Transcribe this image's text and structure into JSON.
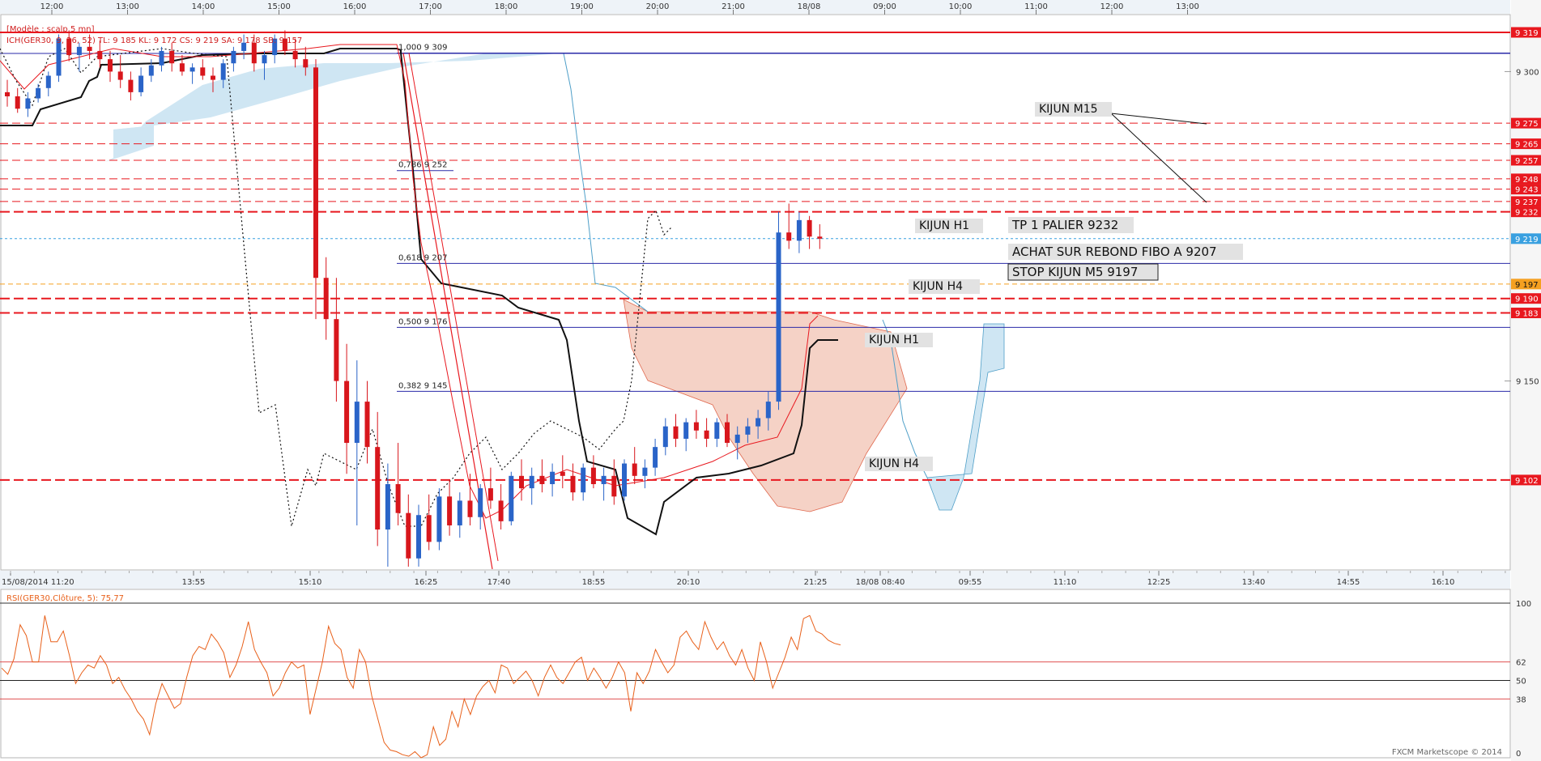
{
  "chart_data": {
    "type": "candlestick",
    "instrument_header": "[Modèle : scalp 5 mn]",
    "indicator_header": "ICH(GER30, 9, 26, 52) TL: 9 185 KL: 9 172 CS: 9 219 SA: 9 178 SB: 9 157",
    "top_time_labels": [
      "12:00",
      "13:00",
      "14:00",
      "15:00",
      "16:00",
      "17:00",
      "18:00",
      "19:00",
      "20:00",
      "21:00",
      "18/08",
      "09:00",
      "10:00",
      "11:00",
      "12:00",
      "13:00"
    ],
    "bottom_time_labels": [
      "15/08/2014 11:20",
      "13:55",
      "15:10",
      "16:25",
      "17:40",
      "18:55",
      "20:10",
      "21:25",
      "18/08 08:40",
      "09:55",
      "11:10",
      "12:25",
      "13:40",
      "14:55",
      "16:10"
    ],
    "y_axis": {
      "ticks": [
        "9 300",
        "9 150"
      ],
      "ylim": [
        9060,
        9330
      ]
    },
    "price_tags": [
      {
        "label": "9 319",
        "value": 9319,
        "color": "#e8181f"
      },
      {
        "label": "9 275",
        "value": 9275,
        "color": "#e8181f"
      },
      {
        "label": "9 265",
        "value": 9265,
        "color": "#e8181f"
      },
      {
        "label": "9 257",
        "value": 9257,
        "color": "#e8181f"
      },
      {
        "label": "9 248",
        "value": 9248,
        "color": "#e8181f"
      },
      {
        "label": "9 243",
        "value": 9243,
        "color": "#e8181f"
      },
      {
        "label": "9 237",
        "value": 9237,
        "color": "#e8181f"
      },
      {
        "label": "9 232",
        "value": 9232,
        "color": "#e8181f"
      },
      {
        "label": "9 219",
        "value": 9219,
        "color": "#39a0e0"
      },
      {
        "label": "9 197",
        "value": 9197,
        "color": "#f5a020"
      },
      {
        "label": "9 190",
        "value": 9190,
        "color": "#e8181f"
      },
      {
        "label": "9 183",
        "value": 9183,
        "color": "#e8181f"
      },
      {
        "label": "9 102",
        "value": 9102,
        "color": "#e8181f"
      }
    ],
    "fib_levels": [
      {
        "label": "1,000 9 309",
        "value": 9309
      },
      {
        "label": "0,786 9 252",
        "value": 9252
      },
      {
        "label": "0,618 9 207",
        "value": 9207
      },
      {
        "label": "0,500 9 176",
        "value": 9176
      },
      {
        "label": "0,382 9 145",
        "value": 9145
      }
    ],
    "annotations": [
      {
        "text": "KIJUN M15"
      },
      {
        "text": "KIJUN H1"
      },
      {
        "text": "TP 1 PALIER 9232"
      },
      {
        "text": "ACHAT SUR REBOND FIBO A 9207"
      },
      {
        "text": "STOP KIJUN M5 9197"
      },
      {
        "text": "KIJUN H4"
      },
      {
        "text": "KIJUN H1"
      },
      {
        "text": "KIJUN H4"
      }
    ],
    "rsi": {
      "label": "RSI(GER30,Clôture, 5): 75,77",
      "levels": [
        "100",
        "62",
        "50",
        "38",
        "0"
      ],
      "values": [
        58,
        54,
        64,
        86,
        79,
        62,
        62,
        92,
        75,
        75,
        82,
        66,
        48,
        55,
        60,
        58,
        66,
        60,
        48,
        52,
        44,
        38,
        30,
        25,
        15,
        35,
        48,
        40,
        32,
        35,
        52,
        66,
        72,
        70,
        80,
        75,
        68,
        52,
        60,
        72,
        88,
        70,
        62,
        55,
        40,
        45,
        55,
        62,
        58,
        60,
        28,
        45,
        62,
        85,
        74,
        70,
        52,
        45,
        70,
        62,
        40,
        25,
        10,
        5,
        4,
        2,
        1,
        4,
        0,
        2,
        20,
        8,
        12,
        30,
        20,
        38,
        28,
        40,
        46,
        50,
        42,
        60,
        58,
        48,
        52,
        56,
        50,
        40,
        52,
        60,
        52,
        48,
        55,
        62,
        65,
        50,
        58,
        52,
        45,
        52,
        62,
        55,
        30,
        55,
        48,
        56,
        70,
        62,
        55,
        60,
        78,
        82,
        75,
        70,
        88,
        78,
        70,
        75,
        66,
        60,
        70,
        58,
        50,
        75,
        62,
        45,
        55,
        65,
        78,
        70,
        90,
        92,
        82,
        80,
        76,
        74,
        73
      ]
    },
    "candles": [
      [
        9290,
        9296,
        9283,
        9288
      ],
      [
        9288,
        9292,
        9280,
        9282
      ],
      [
        9282,
        9290,
        9278,
        9287
      ],
      [
        9287,
        9294,
        9285,
        9292
      ],
      [
        9292,
        9300,
        9288,
        9298
      ],
      [
        9298,
        9318,
        9295,
        9316
      ],
      [
        9316,
        9320,
        9305,
        9308
      ],
      [
        9308,
        9314,
        9300,
        9312
      ],
      [
        9312,
        9318,
        9306,
        9310
      ],
      [
        9310,
        9315,
        9302,
        9306
      ],
      [
        9306,
        9310,
        9295,
        9300
      ],
      [
        9300,
        9308,
        9292,
        9296
      ],
      [
        9296,
        9300,
        9286,
        9290
      ],
      [
        9290,
        9302,
        9288,
        9298
      ],
      [
        9298,
        9306,
        9295,
        9303
      ],
      [
        9303,
        9312,
        9300,
        9310
      ],
      [
        9310,
        9314,
        9300,
        9304
      ],
      [
        9304,
        9308,
        9298,
        9300
      ],
      [
        9300,
        9304,
        9294,
        9302
      ],
      [
        9302,
        9306,
        9296,
        9298
      ],
      [
        9298,
        9302,
        9290,
        9296
      ],
      [
        9296,
        9306,
        9292,
        9304
      ],
      [
        9304,
        9312,
        9300,
        9310
      ],
      [
        9310,
        9318,
        9306,
        9314
      ],
      [
        9314,
        9318,
        9300,
        9304
      ],
      [
        9304,
        9310,
        9296,
        9308
      ],
      [
        9308,
        9318,
        9304,
        9316
      ],
      [
        9316,
        9320,
        9308,
        9310
      ],
      [
        9310,
        9316,
        9302,
        9306
      ],
      [
        9306,
        9312,
        9298,
        9302
      ],
      [
        9302,
        9306,
        9180,
        9200
      ],
      [
        9200,
        9210,
        9170,
        9180
      ],
      [
        9180,
        9200,
        9140,
        9150
      ],
      [
        9150,
        9168,
        9105,
        9120
      ],
      [
        9120,
        9160,
        9080,
        9140
      ],
      [
        9140,
        9150,
        9110,
        9118
      ],
      [
        9118,
        9135,
        9070,
        9078
      ],
      [
        9078,
        9110,
        9060,
        9100
      ],
      [
        9100,
        9120,
        9080,
        9086
      ],
      [
        9086,
        9095,
        9060,
        9064
      ],
      [
        9064,
        9090,
        9060,
        9085
      ],
      [
        9085,
        9095,
        9068,
        9072
      ],
      [
        9072,
        9098,
        9068,
        9094
      ],
      [
        9094,
        9102,
        9075,
        9080
      ],
      [
        9080,
        9096,
        9074,
        9092
      ],
      [
        9092,
        9105,
        9080,
        9084
      ],
      [
        9084,
        9100,
        9078,
        9098
      ],
      [
        9098,
        9108,
        9088,
        9092
      ],
      [
        9092,
        9100,
        9078,
        9082
      ],
      [
        9082,
        9106,
        9080,
        9104
      ],
      [
        9104,
        9112,
        9092,
        9098
      ],
      [
        9098,
        9108,
        9090,
        9104
      ],
      [
        9104,
        9112,
        9096,
        9100
      ],
      [
        9100,
        9110,
        9094,
        9106
      ],
      [
        9106,
        9114,
        9098,
        9104
      ],
      [
        9104,
        9110,
        9092,
        9096
      ],
      [
        9096,
        9110,
        9092,
        9108
      ],
      [
        9108,
        9114,
        9098,
        9100
      ],
      [
        9100,
        9108,
        9092,
        9104
      ],
      [
        9104,
        9112,
        9090,
        9094
      ],
      [
        9094,
        9112,
        9092,
        9110
      ],
      [
        9110,
        9118,
        9100,
        9104
      ],
      [
        9104,
        9112,
        9098,
        9108
      ],
      [
        9108,
        9122,
        9104,
        9118
      ],
      [
        9118,
        9132,
        9114,
        9128
      ],
      [
        9128,
        9134,
        9118,
        9122
      ],
      [
        9122,
        9132,
        9116,
        9130
      ],
      [
        9130,
        9136,
        9122,
        9126
      ],
      [
        9126,
        9132,
        9118,
        9122
      ],
      [
        9122,
        9132,
        9118,
        9130
      ],
      [
        9130,
        9134,
        9118,
        9120
      ],
      [
        9120,
        9128,
        9112,
        9124
      ],
      [
        9124,
        9132,
        9120,
        9128
      ],
      [
        9128,
        9136,
        9122,
        9132
      ],
      [
        9132,
        9145,
        9126,
        9140
      ],
      [
        9140,
        9232,
        9136,
        9222
      ],
      [
        9222,
        9236,
        9214,
        9218
      ],
      [
        9218,
        9232,
        9212,
        9228
      ],
      [
        9228,
        9230,
        9214,
        9220
      ],
      [
        9220,
        9226,
        9214,
        9219
      ]
    ]
  }
}
